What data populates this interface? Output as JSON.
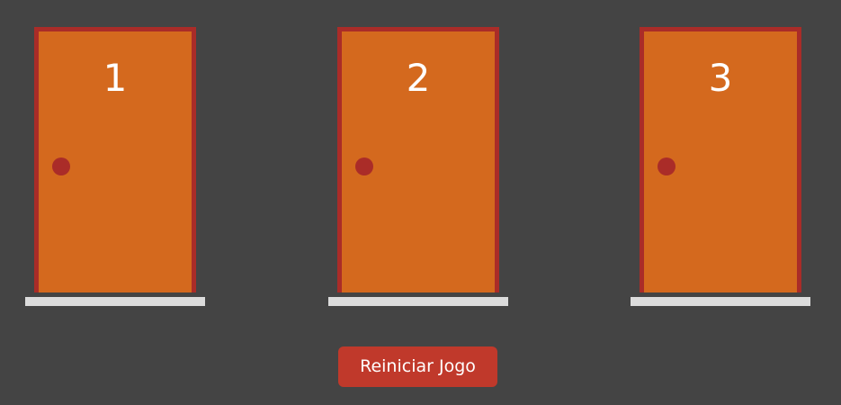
{
  "doors": [
    {
      "number": "1"
    },
    {
      "number": "2"
    },
    {
      "number": "3"
    }
  ],
  "restart_button": {
    "label": "Reiniciar Jogo"
  },
  "colors": {
    "background": "#444444",
    "door": "#d4691e",
    "door_frame": "#aa2c28",
    "knob": "#aa2c28",
    "sill": "#dcdcdc",
    "button": "#c0392b"
  }
}
